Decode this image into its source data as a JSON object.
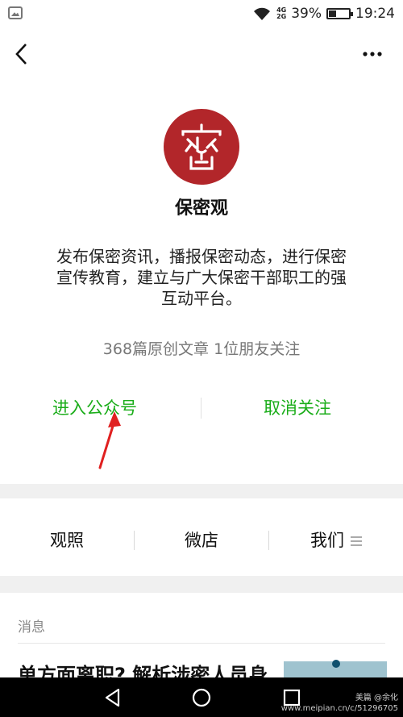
{
  "status_bar": {
    "net_top": "4G",
    "net_bottom": "2G",
    "battery_percent": "39%",
    "battery_level": 0.39,
    "time": "19:24"
  },
  "account": {
    "logo_char": "密",
    "name": "保密观",
    "description": "发布保密资讯，播报保密动态，进行保密宣传教育，建立与广大保密干部职工的强互动平台。",
    "stats": "368篇原创文章  1位朋友关注"
  },
  "actions": {
    "enter_label": "进入公众号",
    "unfollow_label": "取消关注"
  },
  "menu": {
    "items": [
      "观照",
      "微店",
      "我们"
    ]
  },
  "messages": {
    "section_title": "消息",
    "article_title": "单方面离职? 解析涉密人员身"
  },
  "watermark": {
    "brand": "美篇 @余化",
    "url": "www.meipian.cn/c/51296705"
  },
  "colors": {
    "accent_green": "#1aad19",
    "logo_red": "#b2262a",
    "arrow_red": "#e02020"
  },
  "icons": {
    "back": "chevron-left-icon",
    "more": "more-dots-icon",
    "gallery": "gallery-icon",
    "wifi": "wifi-icon",
    "battery": "battery-icon",
    "nav_back": "triangle-back-icon",
    "nav_home": "circle-home-icon",
    "nav_recent": "square-recent-icon"
  }
}
